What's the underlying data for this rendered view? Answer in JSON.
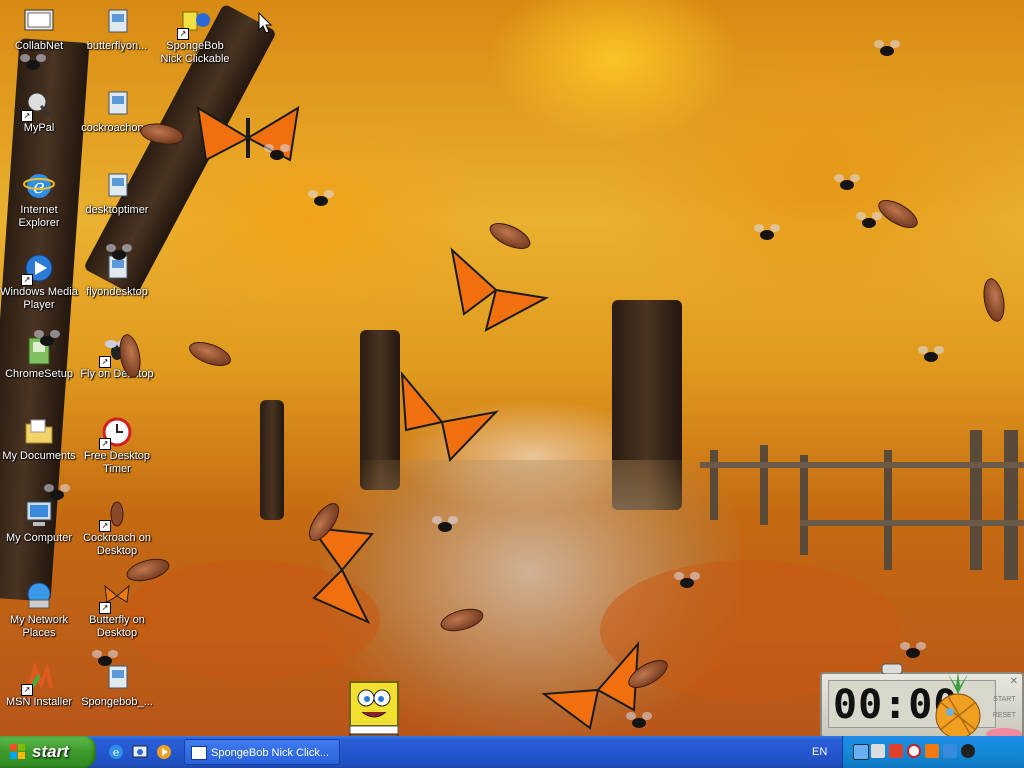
{
  "desktop": {
    "icons": [
      {
        "label": "CollabNet",
        "icon": "collabnet-icon"
      },
      {
        "label": "butterflyon...",
        "icon": "butterfly-installer-icon"
      },
      {
        "label": "SpongeBob Nick Clickable",
        "icon": "spongebob-shortcut-icon"
      },
      {
        "label": "MyPal",
        "icon": "mypal-icon"
      },
      {
        "label": "cockroachon...",
        "icon": "cockroach-installer-icon"
      },
      {
        "label": "Internet Explorer",
        "icon": "internet-explorer-icon"
      },
      {
        "label": "desktoptimer",
        "icon": "desktoptimer-installer-icon"
      },
      {
        "label": "Windows Media Player",
        "icon": "windows-media-player-icon"
      },
      {
        "label": "flyondesktop",
        "icon": "flyondesktop-installer-icon"
      },
      {
        "label": "ChromeSetup",
        "icon": "chrome-setup-icon"
      },
      {
        "label": "Fly on Desktop",
        "icon": "fly-on-desktop-icon"
      },
      {
        "label": "My Documents",
        "icon": "my-documents-icon"
      },
      {
        "label": "Free Desktop Timer",
        "icon": "desktop-timer-icon"
      },
      {
        "label": "My Computer",
        "icon": "my-computer-icon"
      },
      {
        "label": "Cockroach on Desktop",
        "icon": "cockroach-on-desktop-icon"
      },
      {
        "label": "My Network Places",
        "icon": "my-network-places-icon"
      },
      {
        "label": "Butterfly on Desktop",
        "icon": "butterfly-on-desktop-icon"
      },
      {
        "label": "MSN Installer",
        "icon": "msn-installer-icon"
      },
      {
        "label": "Spongebob_...",
        "icon": "spongebob-installer-icon"
      }
    ]
  },
  "timer": {
    "display": "00:00",
    "start_label": "START",
    "reset_label": "RESET"
  },
  "taskbar": {
    "start_label": "start",
    "quick_launch": [
      "internet-explorer-icon",
      "show-desktop-icon",
      "media-player-icon"
    ],
    "task_button_label": "SpongeBob Nick Click...",
    "language": "EN",
    "tray_icons": [
      "network-icon",
      "volume-icon",
      "shield-icon",
      "timer-icon",
      "butterfly-icon",
      "media-icon",
      "fly-icon"
    ]
  },
  "colors": {
    "taskbar_blue": "#2456d0",
    "start_green": "#3c9a2c",
    "tray_blue": "#148ad8",
    "wallpaper_orange": "#e09a1e"
  }
}
